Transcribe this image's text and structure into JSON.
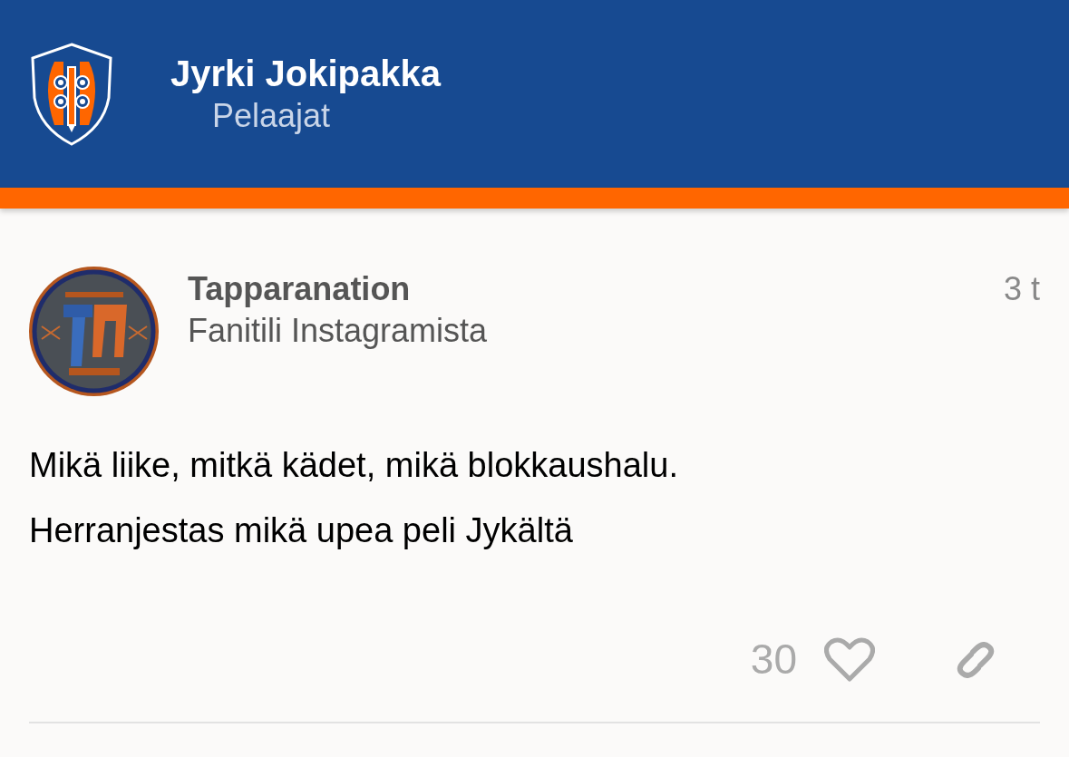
{
  "header": {
    "title": "Jyrki Jokipakka",
    "subtitle": "Pelaajat"
  },
  "post": {
    "author": "Tapparanation",
    "source": "Fanitili Instagramista",
    "time": "3 t",
    "lines": [
      "Mikä liike, mitkä kädet, mikä blokkaushalu.",
      "Herranjestas mikä upea peli Jykältä"
    ],
    "likes": "30",
    "liked": false
  }
}
